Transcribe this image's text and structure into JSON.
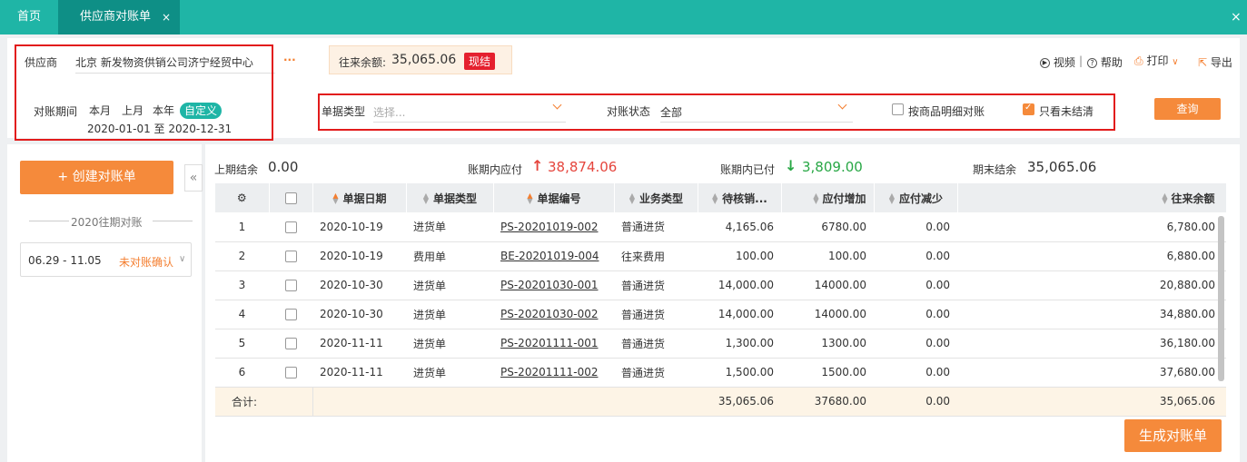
{
  "tabs": {
    "home": "首页",
    "active": "供应商对账单",
    "close": "×"
  },
  "window": {
    "close": "×"
  },
  "supplier": {
    "label": "供应商",
    "value": "北京 新发物资供销公司济宁经贸中心",
    "more": "..."
  },
  "balance": {
    "label": "往来余额:",
    "value": "35,065.06",
    "tag": "现结"
  },
  "toolbar": {
    "video": "视频",
    "sep1": "|",
    "help": "帮助",
    "print": "打印",
    "export": "导出"
  },
  "period": {
    "label": "对账期间",
    "options": [
      "本月",
      "上月",
      "本年",
      "自定义"
    ],
    "range": "2020-01-01 至 2020-12-31"
  },
  "filters": {
    "doc_type_label": "单据类型",
    "doc_type_placeholder": "选择...",
    "status_label": "对账状态",
    "status_value": "全部",
    "detail_check_label": "按商品明细对账",
    "unsettled_check_label": "只看未结清",
    "query_button": "查询"
  },
  "left": {
    "create_button": "+ 创建对账单",
    "collapse": "«",
    "history_title": "2020往期对账",
    "history_item": {
      "range": "06.29 - 11.05",
      "status": "未对账确认"
    }
  },
  "summary": {
    "opening_label": "上期结余",
    "opening_value": "0.00",
    "payable_label": "账期内应付",
    "payable_value": "38,874.06",
    "paid_label": "账期内已付",
    "paid_value": "3,809.00",
    "closing_label": "期末结余",
    "closing_value": "35,065.06"
  },
  "table": {
    "headers": [
      "单据日期",
      "单据类型",
      "单据编号",
      "业务类型",
      "待核销...",
      "应付增加",
      "应付减少",
      "往来余额"
    ],
    "rows": [
      {
        "no": "1",
        "date": "2020-10-19",
        "type": "进货单",
        "code": "PS-20201019-002",
        "biz": "普通进货",
        "pending": "4,165.06",
        "inc": "6780.00",
        "dec": "0.00",
        "bal": "6,780.00"
      },
      {
        "no": "2",
        "date": "2020-10-19",
        "type": "费用单",
        "code": "BE-20201019-004",
        "biz": "往来费用",
        "pending": "100.00",
        "inc": "100.00",
        "dec": "0.00",
        "bal": "6,880.00"
      },
      {
        "no": "3",
        "date": "2020-10-30",
        "type": "进货单",
        "code": "PS-20201030-001",
        "biz": "普通进货",
        "pending": "14,000.00",
        "inc": "14000.00",
        "dec": "0.00",
        "bal": "20,880.00"
      },
      {
        "no": "4",
        "date": "2020-10-30",
        "type": "进货单",
        "code": "PS-20201030-002",
        "biz": "普通进货",
        "pending": "14,000.00",
        "inc": "14000.00",
        "dec": "0.00",
        "bal": "34,880.00"
      },
      {
        "no": "5",
        "date": "2020-11-11",
        "type": "进货单",
        "code": "PS-20201111-001",
        "biz": "普通进货",
        "pending": "1,300.00",
        "inc": "1300.00",
        "dec": "0.00",
        "bal": "36,180.00"
      },
      {
        "no": "6",
        "date": "2020-11-11",
        "type": "进货单",
        "code": "PS-20201111-002",
        "biz": "普通进货",
        "pending": "1,500.00",
        "inc": "1500.00",
        "dec": "0.00",
        "bal": "37,680.00"
      }
    ],
    "total": {
      "label": "合计:",
      "pending": "35,065.06",
      "inc": "37680.00",
      "dec": "0.00",
      "bal": "35,065.06"
    }
  },
  "generate_button": "生成对账单",
  "colors": {
    "teal": "#1fb5a6",
    "orange": "#f58a3b",
    "red_up": "#e5453d",
    "green_down": "#28a745"
  }
}
